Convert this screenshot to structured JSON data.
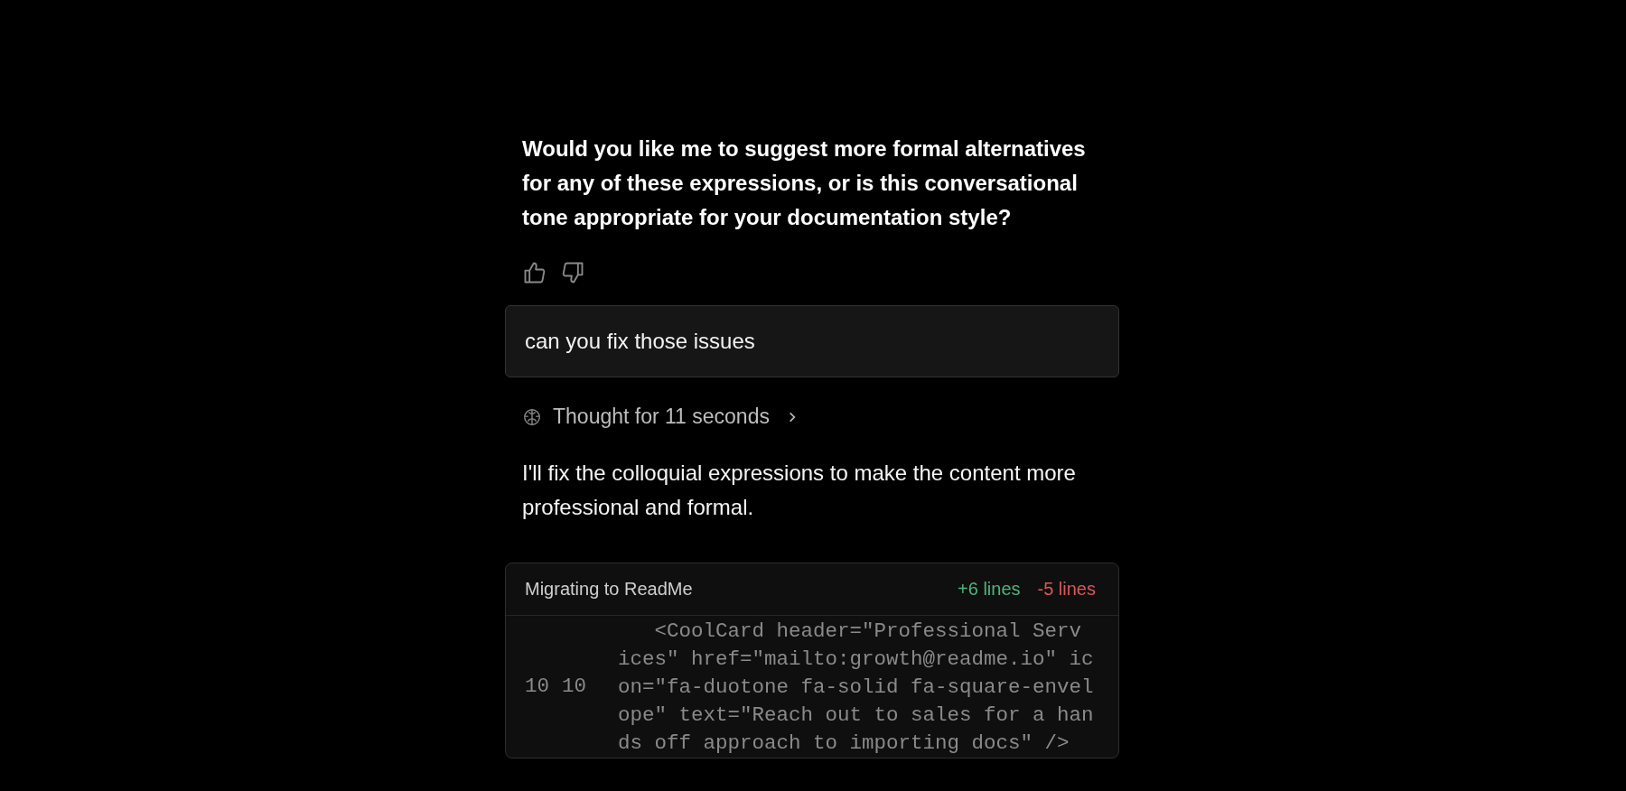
{
  "assistant_question": "Would you like me to suggest more formal alternatives for any of these expressions, or is this conversational tone appropriate for your documentation style?",
  "user_message": "can you fix those issues",
  "thought": {
    "label": "Thought for 11 seconds",
    "expanded": false
  },
  "assistant_reply": "I'll fix the colloquial expressions to make the content more professional and formal.",
  "diff": {
    "title": "Migrating to ReadMe",
    "added": "+6 lines",
    "removed": "-5 lines",
    "rows": [
      {
        "old_line": "10",
        "new_line": "10",
        "code": "   <CoolCard header=\"Professional Services\" href=\"mailto:growth@readme.io\" icon=\"fa-duotone fa-solid fa-square-envelope\" text=\"Reach out to sales for a hands off approach to importing docs\" />"
      }
    ]
  }
}
